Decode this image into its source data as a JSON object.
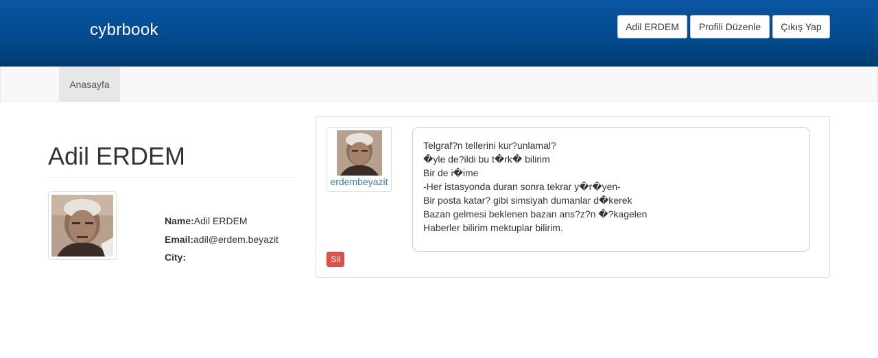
{
  "header": {
    "brand": "cybrbook",
    "user_button": "Adil ERDEM",
    "edit_profile_button": "Profili Düzenle",
    "logout_button": "Çıkış Yap"
  },
  "nav": {
    "items": [
      {
        "label": "Anasayfa"
      }
    ]
  },
  "profile": {
    "title": "Adil ERDEM",
    "name_label": "Name:",
    "name_value": "Adil ERDEM",
    "email_label": "Email:",
    "email_value": "adil@erdem.beyazit",
    "city_label": "City:",
    "city_value": ""
  },
  "post": {
    "author": "erdembeyazit",
    "lines": [
      "Telgraf?n tellerini kur?unlamal?",
      "�yle de?ildi bu t�rk� bilirim",
      "Bir de i�ime",
      "-Her istasyonda duran sonra tekrar y�r�yen-",
      "Bir posta katar? gibi simsiyah dumanlar d�kerek",
      "Bazan gelmesi beklenen bazan ans?z?n �?kagelen",
      "Haberler bilirim mektuplar bilirim."
    ],
    "delete_button": "Sil"
  },
  "colors": {
    "header_bg": "#034a8c",
    "link": "#337ab7",
    "danger": "#d9534f"
  }
}
